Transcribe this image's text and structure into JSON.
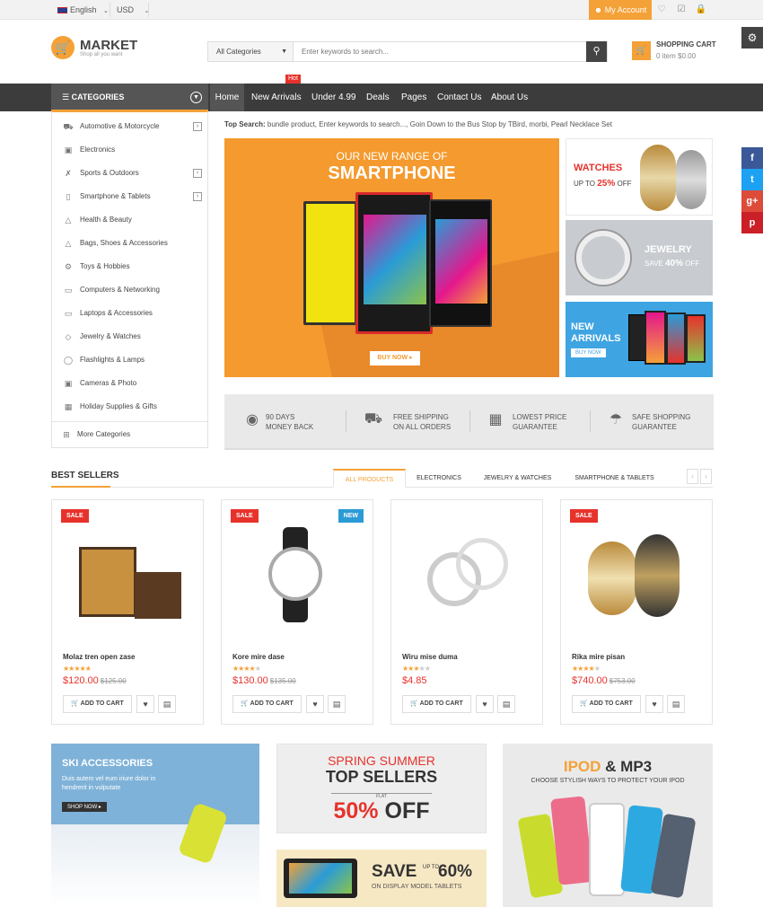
{
  "topbar": {
    "language": "English",
    "currency": "USD",
    "my_account": "My Account"
  },
  "logo": {
    "name": "MARKET",
    "tagline": "Shop all you want"
  },
  "search": {
    "category": "All Categories",
    "placeholder": "Enter keywords to search..."
  },
  "cart": {
    "title": "SHOPPING CART",
    "summary": "0 item $0.00"
  },
  "categories_heading": "CATEGORIES",
  "nav": {
    "items": [
      "Home",
      "New Arrivals",
      "Under 4.99",
      "Deals",
      "Pages",
      "Contact Us",
      "About Us"
    ],
    "hot_badge": "Hot"
  },
  "categories": [
    "Automotive & Motorcycle",
    "Electronics",
    "Sports & Outdoors",
    "Smartphone & Tablets",
    "Health & Beauty",
    "Bags, Shoes & Accessories",
    "Toys & Hobbies",
    "Computers & Networking",
    "Laptops & Accessories",
    "Jewelry & Watches",
    "Flashlights & Lamps",
    "Cameras & Photo",
    "Holiday Supplies & Gifts"
  ],
  "more_categories": "More Categories",
  "top_search": {
    "label": "Top Search:",
    "terms": "bundle product,  Enter keywords to search...,  Goin Down to the Bus Stop by TBird,  morbi,  Pearl Necklace Set"
  },
  "slider": {
    "line1": "OUR NEW RANGE OF",
    "line2": "SMARTPHONE",
    "button": "BUY NOW"
  },
  "banners": {
    "watches": {
      "title": "WATCHES",
      "sub": "UP TO",
      "pct": "25%",
      "off": "OFF"
    },
    "jewelry": {
      "title": "JEWELRY",
      "sub": "SAVE",
      "pct": "40%",
      "off": "OFF"
    },
    "new_arrivals": {
      "l1": "NEW",
      "l2": "ARRIVALS",
      "button": "BUY NOW"
    }
  },
  "features": [
    {
      "l1": "90 DAYS",
      "l2": "MONEY BACK",
      "icon": "money-bag-icon"
    },
    {
      "l1": "FREE SHIPPING",
      "l2": "ON ALL ORDERS",
      "icon": "truck-icon"
    },
    {
      "l1": "LOWEST PRICE",
      "l2": "GUARANTEE",
      "icon": "calendar-icon"
    },
    {
      "l1": "SAFE SHOPPING",
      "l2": "GUARANTEE",
      "icon": "umbrella-icon"
    }
  ],
  "best_sellers": {
    "title": "BEST SELLERS",
    "tabs": [
      "ALL PRODUCTS",
      "ELECTRONICS",
      "JEWELRY & WATCHES",
      "SMARTPHONE & TABLETS"
    ],
    "add_to_cart": "ADD TO CART",
    "products": [
      {
        "name": "Molaz tren open zase",
        "price": "$120.00",
        "old_price": "$125.00",
        "rating": 5,
        "badges": [
          "SALE"
        ]
      },
      {
        "name": "Kore mire dase",
        "price": "$130.00",
        "old_price": "$135.00",
        "rating": 4.5,
        "badges": [
          "SALE",
          "NEW"
        ]
      },
      {
        "name": "Wiru mise duma",
        "price": "$4.85",
        "old_price": "",
        "rating": 3.5,
        "badges": []
      },
      {
        "name": "Rika mire pisan",
        "price": "$740.00",
        "old_price": "$753.00",
        "rating": 4.5,
        "badges": [
          "SALE"
        ]
      }
    ]
  },
  "bottom_banners": {
    "ski": {
      "title": "SKI ACCESSORIES",
      "text": "Duis autem vel eum iriure dolor in hendrerit in vulputate",
      "button": "SHOP NOW"
    },
    "spring": {
      "l1": "SPRING SUMMER",
      "l2": "TOP SELLERS",
      "flat": "FLAT",
      "pct": "50%",
      "off": "OFF"
    },
    "tablet": {
      "save": "SAVE",
      "upto": "UP TO",
      "pct": "60%",
      "sub": "ON DISPLAY MODEL TABLETS"
    },
    "ipod": {
      "t1": "IPOD",
      "amp": "& MP3",
      "sub": "CHOOSE STYLISH WAYS TO PROTECT YOUR IPOD"
    }
  },
  "social": [
    "f",
    "t",
    "g+",
    "p"
  ],
  "colors": {
    "accent": "#f4a137",
    "nav": "#3c3c3c",
    "sale": "#e7322c",
    "new": "#2b9bd6"
  }
}
